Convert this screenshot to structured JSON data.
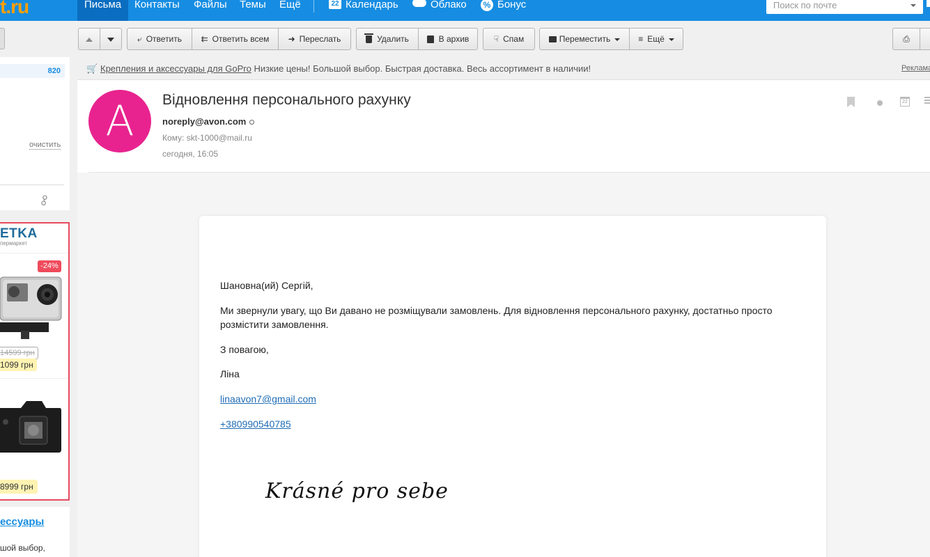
{
  "topnav": {
    "logo": "t.ru",
    "items": [
      "Письма",
      "Контакты",
      "Файлы",
      "Темы",
      "Ещё"
    ],
    "calendar_badge": "22",
    "calendar": "Календарь",
    "cloud": "Облако",
    "bonus": "Бонус",
    "search_placeholder": "Поиск по почте"
  },
  "left": {
    "count": "820",
    "clear": "очистить",
    "ad_logo": "ETKA",
    "ad_sub": "пермаркет",
    "discount": "-24%",
    "old_price": "14599 грн",
    "new_price": "1099 грн",
    "new_price2": "8999 грн",
    "ad2_link": "ессуары",
    "ad2_text": "шой выбор,"
  },
  "toolbar": {
    "reply": "Ответить",
    "reply_all": "Ответить всем",
    "forward": "Переслать",
    "delete": "Удалить",
    "archive": "В архив",
    "spam": "Спам",
    "move": "Переместить",
    "more": "Ещё"
  },
  "ad_strip": {
    "link": "Крепления и аксессуары для GoPro",
    "text": "Низкие цены! Большой выбор. Быстрая доставка. Весь ассортимент в наличии!",
    "label": "Реклама"
  },
  "message": {
    "avatar_letter": "A",
    "subject": "Відновлення персонального рахунку",
    "from": "noreply@avon.com",
    "to": "Кому: skt-1000@mail.ru",
    "date": "сегодня, 16:05",
    "calendar_icon_num": "22"
  },
  "body": {
    "greeting": "Шановна(ий) Сергій,",
    "main": "Ми звернули увагу, що Ви давано не розміщували замовлень. Для відновлення персонального рахунку, достатньо просто розмістити замовлення.",
    "regards": "З повагою,",
    "name": "Ліна",
    "email": "linaavon7@gmail.com",
    "phone": "+380990540785",
    "script": "Krásné pro sebe"
  },
  "colors": {
    "nav_bg": "#168de2",
    "avatar": "#e8238f",
    "ad_border": "#e84a5f",
    "link": "#1f6cb5"
  }
}
